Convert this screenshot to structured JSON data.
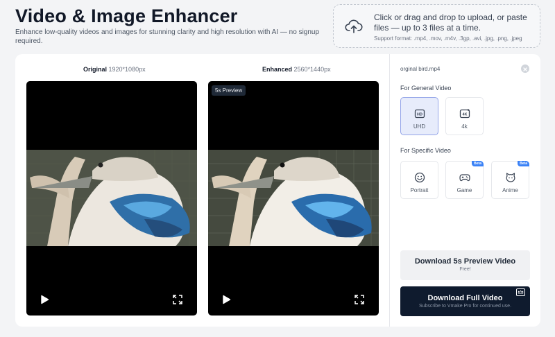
{
  "header": {
    "title": "Video & Image Enhancer",
    "subtitle": "Enhance low-quality videos and images for stunning clarity and high resolution with AI — no signup required."
  },
  "upload": {
    "main_text": "Click or drag and drop to upload, or paste files — up to 3 files at a time.",
    "formats": "Support format: .mp4, .mov, .m4v, .3gp, .avi, .jpg, .png, .jpeg"
  },
  "compare": {
    "original": {
      "label": "Original",
      "resolution": "1920*1080px"
    },
    "enhanced": {
      "label": "Enhanced",
      "resolution": "2560*1440px",
      "badge": "5s Preview"
    }
  },
  "panel": {
    "file_name": "orginal bird.mp4",
    "general_title": "For General Video",
    "general_options": [
      {
        "label": "UHD",
        "icon": "hd-icon",
        "selected": true
      },
      {
        "label": "4k",
        "icon": "4k-icon",
        "selected": false
      }
    ],
    "specific_title": "For Specific Video",
    "specific_options": [
      {
        "label": "Portrait",
        "icon": "smile-icon",
        "beta": ""
      },
      {
        "label": "Game",
        "icon": "gamepad-icon",
        "beta": "Beta"
      },
      {
        "label": "Anime",
        "icon": "cat-face-icon",
        "beta": "Beta"
      }
    ],
    "preview_button": {
      "label": "Download 5s Preview Video",
      "sub": "Free!"
    },
    "full_button": {
      "label": "Download Full Video",
      "sub": "Subscribe to Vmake Pro for continued use."
    }
  },
  "colors": {
    "accent": "#3b82f6",
    "dark_button": "#0f1b2e",
    "selected_bg": "#e7ecfb"
  }
}
